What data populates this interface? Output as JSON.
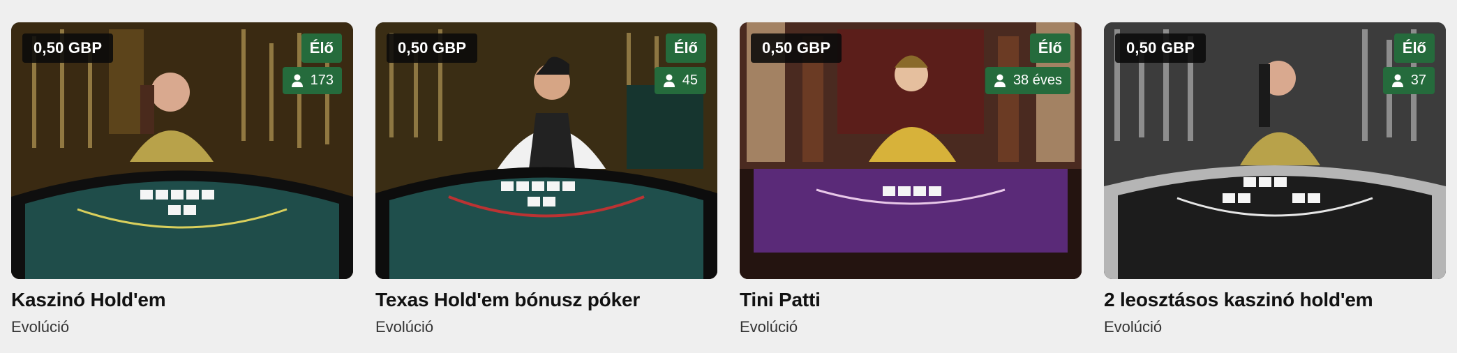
{
  "cards": [
    {
      "price": "0,50 GBP",
      "live": "Élő",
      "players": "173",
      "title": "Kaszinó Hold'em",
      "provider": "Evolúció",
      "colors": {
        "backdrop": "#3a2a12",
        "felt": "#1f4d4a",
        "dealer": "#b8a24a"
      }
    },
    {
      "price": "0,50 GBP",
      "live": "Élő",
      "players": "45",
      "title": "Texas Hold'em bónusz póker",
      "provider": "Evolúció",
      "colors": {
        "backdrop": "#3a2d14",
        "felt": "#1f4f4c",
        "dealer": "#222222"
      }
    },
    {
      "price": "0,50 GBP",
      "live": "Élő",
      "players": "38 éves",
      "title": "Tini Patti",
      "provider": "Evolúció",
      "colors": {
        "backdrop": "#4a2a20",
        "felt": "#5a2a78",
        "dealer": "#d7b23a"
      }
    },
    {
      "price": "0,50 GBP",
      "live": "Élő",
      "players": "37",
      "title": "2 leosztásos kaszinó hold'em",
      "provider": "Evolúció",
      "colors": {
        "backdrop": "#3c3c3c",
        "felt": "#1c1c1c",
        "dealer": "#b8a24a"
      }
    }
  ]
}
